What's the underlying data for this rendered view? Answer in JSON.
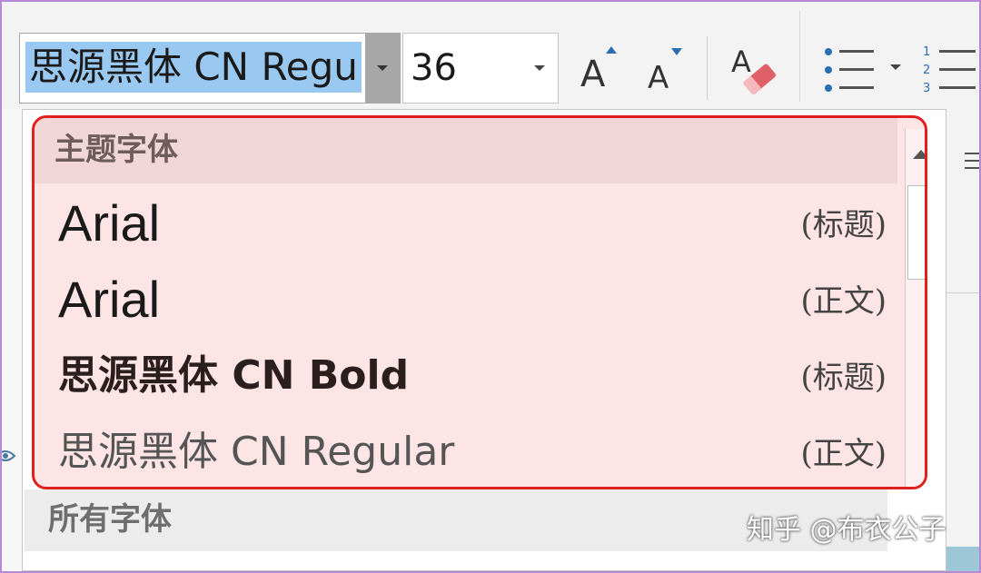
{
  "ribbon": {
    "font_name_value": "思源黑体 CN Regu",
    "font_size_value": "36"
  },
  "theme_fonts": {
    "header": "主题字体",
    "items": [
      {
        "name": "Arial",
        "tag": "(标题)",
        "style": "arial"
      },
      {
        "name": "Arial",
        "tag": "(正文)",
        "style": "arial"
      },
      {
        "name": "思源黑体 CN Bold",
        "tag": "(标题)",
        "style": "bold"
      },
      {
        "name": "思源黑体 CN Regular",
        "tag": "(正文)",
        "style": "regular"
      }
    ]
  },
  "all_fonts": {
    "header": "所有字体"
  },
  "watermark": "知乎 @布衣公子",
  "colors": {
    "highlight_border": "#e0201c",
    "highlight_fill": "#fde4e5",
    "selection": "#99c8f0",
    "frame": "#b88ad6"
  },
  "icons": {
    "grow_font": "grow-font-icon",
    "shrink_font": "shrink-font-icon",
    "clear_formatting": "clear-formatting-icon",
    "bullets": "bullets-icon",
    "numbering": "numbering-icon"
  }
}
